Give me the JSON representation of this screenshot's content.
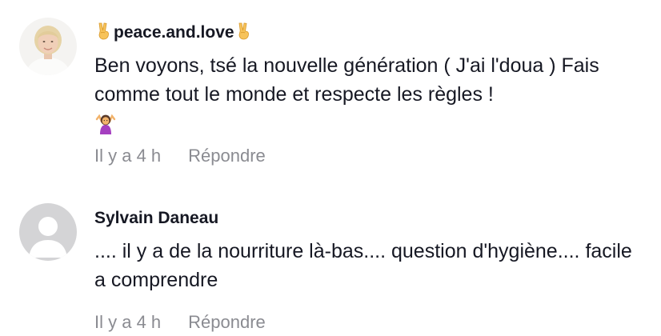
{
  "comments": [
    {
      "username": "peace.and.love",
      "username_prefix_emoji": "victory-hand-icon",
      "username_suffix_emoji": "victory-hand-icon",
      "text": "Ben voyons, tsé la nouvelle génération ( J'ai l'doua ) Fais comme tout le monde et respecte les règles !",
      "trailing_emoji": "person-shrugging-icon",
      "time": "Il y a 4 h",
      "reply_label": "Répondre"
    },
    {
      "username": "Sylvain Daneau",
      "avatar": "default-avatar-icon",
      "text": ".... il y a de la nourriture là-bas.... question d'hygiène.... facile a comprendre",
      "time": "Il y a 4 h",
      "reply_label": "Répondre"
    }
  ],
  "colors": {
    "text": "#161823",
    "meta": "#8a8b91",
    "default_avatar_bg": "#d4d4d6",
    "default_avatar_fg": "#ffffff"
  }
}
